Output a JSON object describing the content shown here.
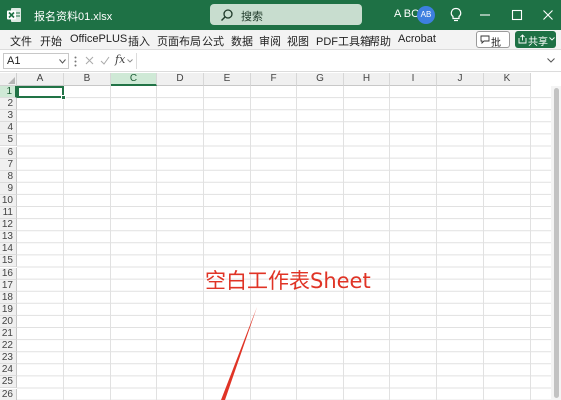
{
  "titlebar": {
    "filename": "报名资料01.xlsx",
    "search_placeholder": "搜索",
    "user_name": "A BC",
    "avatar_initials": "AB",
    "accent_color": "#1e7145"
  },
  "menu": {
    "items": [
      "文件",
      "开始",
      "OfficePLUS",
      "插入",
      "页面布局",
      "公式",
      "数据",
      "审阅",
      "视图",
      "PDF工具箱",
      "帮助",
      "Acrobat"
    ],
    "comment_label": "批注",
    "share_label": "共享"
  },
  "formula_bar": {
    "name_box": "A1",
    "fx_label": "fx",
    "formula_value": ""
  },
  "grid": {
    "columns": [
      "A",
      "B",
      "C",
      "D",
      "E",
      "F",
      "G",
      "H",
      "I",
      "J",
      "K"
    ],
    "rows": [
      "1",
      "2",
      "3",
      "4",
      "5",
      "6",
      "7",
      "8",
      "9",
      "10",
      "11",
      "12",
      "13",
      "14",
      "15",
      "16",
      "17",
      "18",
      "19",
      "20",
      "21",
      "22",
      "23",
      "24",
      "25",
      "26"
    ],
    "active_cell": "A1",
    "highlight_column": "C",
    "selection_color": "#217346"
  },
  "annotation": {
    "text": "空白工作表Sheet",
    "color": "#e03426"
  }
}
